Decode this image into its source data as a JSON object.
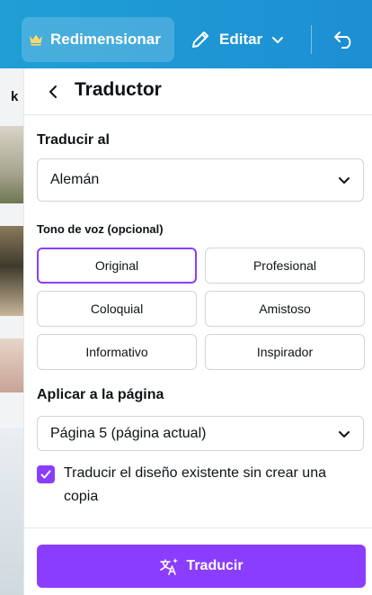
{
  "toolbar": {
    "resize_label": "Redimensionar",
    "edit_label": "Editar"
  },
  "canvas": {
    "partial_letter": "k"
  },
  "panel": {
    "title": "Traductor",
    "language_label": "Traducir al",
    "language_value": "Alemán",
    "tone_label": "Tono de voz (opcional)",
    "tones": [
      {
        "label": "Original",
        "selected": true
      },
      {
        "label": "Profesional",
        "selected": false
      },
      {
        "label": "Coloquial",
        "selected": false
      },
      {
        "label": "Amistoso",
        "selected": false
      },
      {
        "label": "Informativo",
        "selected": false
      },
      {
        "label": "Inspirador",
        "selected": false
      }
    ],
    "page_label": "Aplicar a la página",
    "page_value": "Página 5 (página actual)",
    "checkbox_label": "Traducir el diseño existente sin crear una copia",
    "checkbox_checked": true,
    "translate_button": "Traducir"
  },
  "colors": {
    "toolbar": "#1f9fd6",
    "accent": "#8b3dff"
  },
  "icons": {
    "resize": "crown-icon",
    "edit": "pencil-icon",
    "undo": "undo-icon",
    "back": "chevron-left-icon",
    "dropdown": "chevron-down-icon",
    "translate": "translate-sparkle-icon"
  }
}
